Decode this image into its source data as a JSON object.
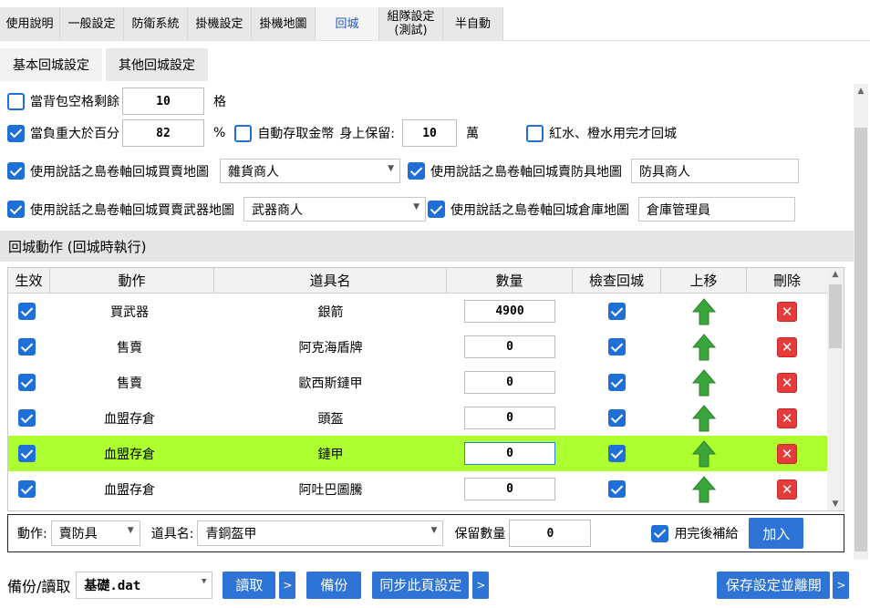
{
  "tabs": [
    {
      "label": "使用說明"
    },
    {
      "label": "一般設定"
    },
    {
      "label": "防衛系統"
    },
    {
      "label": "掛機設定"
    },
    {
      "label": "掛機地圖"
    },
    {
      "label": "回城"
    },
    {
      "label": "組隊設定\n(測試)"
    },
    {
      "label": "半自動"
    }
  ],
  "subtabs": [
    {
      "label": "基本回城設定"
    },
    {
      "label": "其他回城設定"
    }
  ],
  "settings": {
    "bag_free_label": "當背包空格剩餘",
    "bag_free_value": "10",
    "bag_free_unit": "格",
    "weight_label": "當負重大於百分",
    "weight_value": "82",
    "weight_unit": "%",
    "auto_deposit_label": "自動存取金幣",
    "keep_label": "身上保留:",
    "keep_value": "10",
    "keep_unit": "萬",
    "potion_label": "紅水、橙水用完才回城",
    "buy_grocery_label": "使用說話之島卷軸回城買賣地圖",
    "buy_grocery_value": "雜貨商人",
    "buy_armor_label": "使用說話之島卷軸回城賣防具地圖",
    "buy_armor_value": "防具商人",
    "buy_weapon_label": "使用說話之島卷軸回城買賣武器地圖",
    "buy_weapon_value": "武器商人",
    "warehouse_label": "使用說話之島卷軸回城倉庫地圖",
    "warehouse_value": "倉庫管理員"
  },
  "section_title": "回城動作 (回城時執行)",
  "grid": {
    "headers": [
      "生效",
      "動作",
      "道具名",
      "數量",
      "檢查回城",
      "上移",
      "刪除"
    ],
    "rows": [
      {
        "enabled": true,
        "action": "買武器",
        "item": "銀箭",
        "qty": "4900",
        "check": true,
        "highlight": false
      },
      {
        "enabled": true,
        "action": "售賣",
        "item": "阿克海盾牌",
        "qty": "0",
        "check": true,
        "highlight": false
      },
      {
        "enabled": true,
        "action": "售賣",
        "item": "歐西斯鏈甲",
        "qty": "0",
        "check": true,
        "highlight": false
      },
      {
        "enabled": true,
        "action": "血盟存倉",
        "item": "頭盔",
        "qty": "0",
        "check": true,
        "highlight": false
      },
      {
        "enabled": true,
        "action": "血盟存倉",
        "item": "鏈甲",
        "qty": "0",
        "check": true,
        "highlight": true
      },
      {
        "enabled": true,
        "action": "血盟存倉",
        "item": "阿吐巴圖騰",
        "qty": "0",
        "check": true,
        "highlight": false
      }
    ]
  },
  "editor": {
    "action_label": "動作:",
    "action_value": "賣防具",
    "item_label": "道具名:",
    "item_value": "青銅盔甲",
    "keep_qty_label": "保留數量",
    "keep_qty_value": "0",
    "refill_label": "用完後補給",
    "add_label": "加入"
  },
  "bottom": {
    "backup_label": "備份/讀取",
    "file_value": "基礎.dat",
    "read_label": "讀取",
    "arrow": ">",
    "backup_button": "備份",
    "sync_label": "同步此頁設定",
    "save_exit_label": "保存設定並離開"
  },
  "colors": {
    "accent": "#2e73d6",
    "highlight_row": "#adff2f",
    "delete_red": "#e53b3b",
    "up_green": "#3aa53a"
  }
}
